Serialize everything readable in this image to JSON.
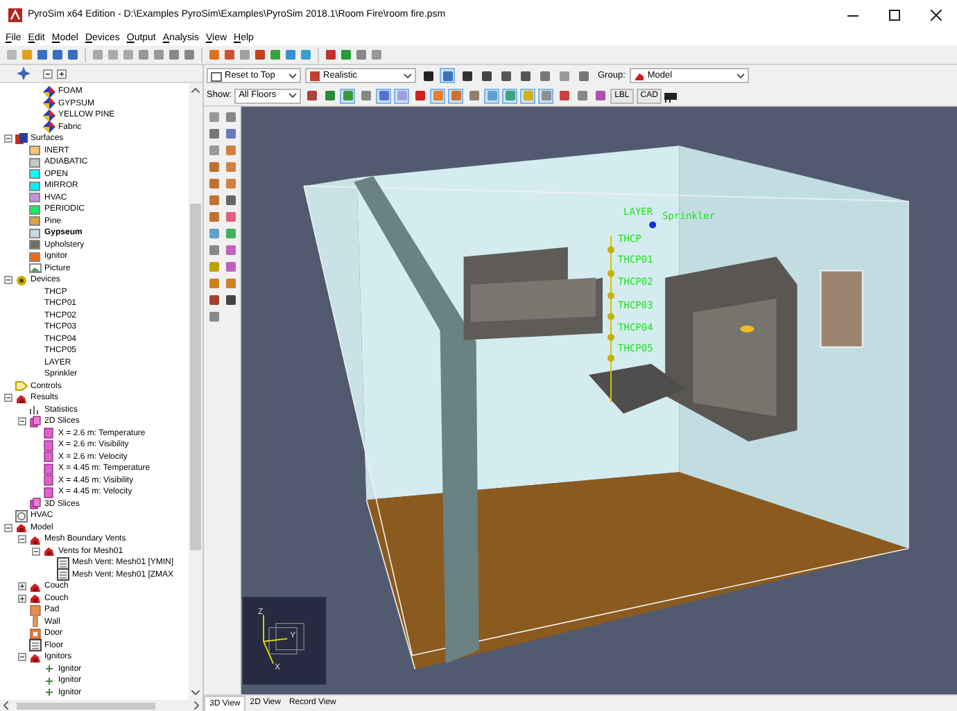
{
  "window": {
    "title": "PyroSim x64 Edition - D:\\Examples PyroSim\\Examples\\PyroSim 2018.1\\Room Fire\\room fire.psm"
  },
  "menu": [
    "File",
    "Edit",
    "Model",
    "Devices",
    "Output",
    "Analysis",
    "View",
    "Help"
  ],
  "tree": {
    "items": [
      {
        "children": [
          {
            "label": "FOAM",
            "kind": "material"
          },
          {
            "label": "GYPSUM",
            "kind": "material"
          },
          {
            "label": "YELLOW PINE",
            "kind": "material"
          },
          {
            "label": "Fabric",
            "kind": "material"
          }
        ]
      },
      {
        "label": "Surfaces",
        "kind": "surfaces",
        "expanded": true,
        "children": [
          {
            "label": "INERT",
            "kind": "surface",
            "color": "#f7c46c",
            "bold": false
          },
          {
            "label": "ADIABATIC",
            "kind": "surface",
            "color": "#c8c8c8",
            "bold": false
          },
          {
            "label": "OPEN",
            "kind": "surface",
            "color": "#00ffff",
            "bold": false
          },
          {
            "label": "MIRROR",
            "kind": "surface",
            "color": "#00f0ff",
            "bold": false
          },
          {
            "label": "HVAC",
            "kind": "surface",
            "color": "#c890e0",
            "bold": false
          },
          {
            "label": "PERIODIC",
            "kind": "surface",
            "color": "#10ef60",
            "bold": false
          },
          {
            "label": "Pine",
            "kind": "surface",
            "color": "#d9a640",
            "bold": false
          },
          {
            "label": "Gypseum",
            "kind": "surface",
            "color": "#c4dde0",
            "bold": true
          },
          {
            "label": "Upholstery",
            "kind": "surface",
            "color": "#6e6e66",
            "bold": false
          },
          {
            "label": "Ignitor",
            "kind": "surface",
            "color": "#f26a10",
            "bold": false
          },
          {
            "label": "Picture",
            "kind": "picture"
          }
        ]
      },
      {
        "label": "Devices",
        "kind": "devices",
        "expanded": true,
        "children": [
          {
            "label": "THCP",
            "kind": "device"
          },
          {
            "label": "THCP01",
            "kind": "device"
          },
          {
            "label": "THCP02",
            "kind": "device"
          },
          {
            "label": "THCP03",
            "kind": "device"
          },
          {
            "label": "THCP04",
            "kind": "device"
          },
          {
            "label": "THCP05",
            "kind": "device"
          },
          {
            "label": "LAYER",
            "kind": "device"
          },
          {
            "label": "Sprinkler",
            "kind": "device"
          }
        ]
      },
      {
        "label": "Controls",
        "kind": "controls"
      },
      {
        "label": "Results",
        "kind": "group",
        "expanded": true,
        "children": [
          {
            "label": "Statistics",
            "kind": "stats"
          },
          {
            "label": "2D Slices",
            "kind": "slices",
            "expanded": true,
            "children": [
              {
                "label": "X = 2.6 m: Temperature",
                "kind": "slice"
              },
              {
                "label": "X = 2.6 m: Visibility",
                "kind": "slice"
              },
              {
                "label": "X = 2.6 m: Velocity",
                "kind": "slice"
              },
              {
                "label": "X = 4.45 m: Temperature",
                "kind": "slice"
              },
              {
                "label": "X = 4.45 m: Visibility",
                "kind": "slice"
              },
              {
                "label": "X = 4.45 m: Velocity",
                "kind": "slice"
              }
            ]
          },
          {
            "label": "3D Slices",
            "kind": "slices"
          }
        ]
      },
      {
        "label": "HVAC",
        "kind": "hvac"
      },
      {
        "label": "Model",
        "kind": "group",
        "expanded": true,
        "children": [
          {
            "label": "Mesh Boundary Vents",
            "kind": "group",
            "expanded": true,
            "children": [
              {
                "label": "Vents for Mesh01",
                "kind": "group",
                "expanded": true,
                "children": [
                  {
                    "label": "Mesh Vent: Mesh01 [YMIN]",
                    "kind": "vent"
                  },
                  {
                    "label": "Mesh Vent: Mesh01 [ZMAX",
                    "kind": "vent"
                  }
                ]
              }
            ]
          },
          {
            "label": "Couch",
            "kind": "group",
            "expanded": false
          },
          {
            "label": "Couch",
            "kind": "group",
            "expanded": false
          },
          {
            "label": "Pad",
            "kind": "block"
          },
          {
            "label": "Wall",
            "kind": "wall"
          },
          {
            "label": "Door",
            "kind": "door"
          },
          {
            "label": "Floor",
            "kind": "vent"
          },
          {
            "label": "Ignitors",
            "kind": "group",
            "expanded": true,
            "children": [
              {
                "label": "Ignitor",
                "kind": "ignitor"
              },
              {
                "label": "Ignitor",
                "kind": "ignitor"
              },
              {
                "label": "Ignitor",
                "kind": "ignitor"
              }
            ]
          }
        ]
      }
    ]
  },
  "view_toolbar": {
    "camera": "Reset to Top",
    "render_mode": "Realistic",
    "tools": [
      {
        "selected": false
      },
      {
        "selected": true
      },
      {
        "selected": false
      },
      {
        "selected": false
      },
      {
        "selected": false
      },
      {
        "selected": false
      },
      {
        "selected": false
      },
      {
        "selected": false
      },
      {
        "selected": false
      }
    ],
    "group_label": "Group:",
    "group": "Model"
  },
  "show_toolbar": {
    "show_label": "Show:",
    "floors": "All Floors",
    "tools": [
      {
        "selected": false
      },
      {
        "selected": false
      },
      {
        "selected": true
      },
      {
        "selected": false
      },
      {
        "selected": true
      },
      {
        "selected": true
      },
      {
        "selected": false
      },
      {
        "selected": true
      },
      {
        "selected": true
      },
      {
        "selected": false
      },
      {
        "selected": true
      },
      {
        "selected": true
      },
      {
        "selected": true
      },
      {
        "selected": true
      },
      {
        "selected": false
      },
      {
        "selected": false
      },
      {
        "selected": false
      }
    ],
    "labels_button": "LBL",
    "cad_button": "CAD"
  },
  "scene": {
    "labels": [
      {
        "label": "LAYER"
      },
      {
        "label": "Sprinkler"
      },
      {
        "label": "THCP"
      },
      {
        "label": "THCP01"
      },
      {
        "label": "THCP02"
      },
      {
        "label": "THCP03"
      },
      {
        "label": "THCP04"
      },
      {
        "label": "THCP05"
      }
    ],
    "axes": [
      "Z",
      "Y",
      "X"
    ]
  },
  "tabs": [
    {
      "label": "3D View",
      "selected": true
    },
    {
      "label": "2D View",
      "selected": false
    },
    {
      "label": "Record View",
      "selected": false
    }
  ]
}
